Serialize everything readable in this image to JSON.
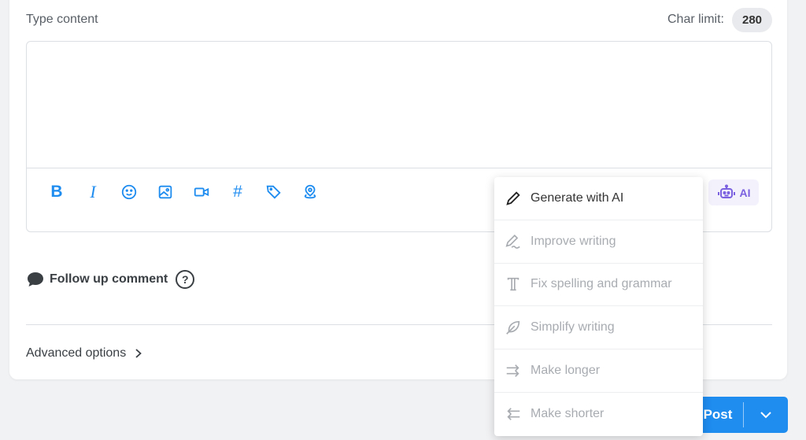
{
  "composer": {
    "content_label": "Type content",
    "char_limit_label": "Char limit:",
    "char_limit_value": "280",
    "editor_value": "",
    "toolbar": {
      "bold_label": "B",
      "italic_label": "I",
      "hashtag_label": "#",
      "ai_label": "AI"
    }
  },
  "follow_up": {
    "label": "Follow up comment",
    "help_label": "?"
  },
  "advanced": {
    "label": "Advanced options"
  },
  "post_button": {
    "label": "Post"
  },
  "ai_menu": {
    "items": [
      {
        "label": "Generate with AI",
        "icon": "pen-icon",
        "enabled": true
      },
      {
        "label": "Improve writing",
        "icon": "pen-wave-icon",
        "enabled": false
      },
      {
        "label": "Fix spelling and grammar",
        "icon": "text-t-icon",
        "enabled": false
      },
      {
        "label": "Simplify writing",
        "icon": "feather-icon",
        "enabled": false
      },
      {
        "label": "Make longer",
        "icon": "arrows-expand-icon",
        "enabled": false
      },
      {
        "label": "Make shorter",
        "icon": "arrows-compress-icon",
        "enabled": false
      }
    ]
  },
  "colors": {
    "accent": "#1f8cf0",
    "ai_purple": "#7b61e0",
    "disabled_text": "#a8acb1",
    "background": "#f1f2f4"
  }
}
